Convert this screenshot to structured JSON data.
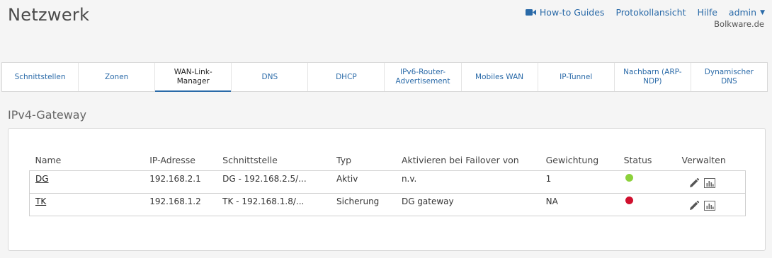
{
  "header": {
    "title": "Netzwerk",
    "hostname": "Bolkware.de",
    "nav": {
      "howto": "How-to Guides",
      "log": "Protokollansicht",
      "help": "Hilfe",
      "user": "admin"
    }
  },
  "tabs": [
    {
      "label": "Schnittstellen"
    },
    {
      "label": "Zonen"
    },
    {
      "label": "WAN-Link-Manager",
      "active": true
    },
    {
      "label": "DNS"
    },
    {
      "label": "DHCP"
    },
    {
      "label": "IPv6-Router-Advertisement"
    },
    {
      "label": "Mobiles WAN"
    },
    {
      "label": "IP-Tunnel"
    },
    {
      "label": "Nachbarn (ARP-NDP)"
    },
    {
      "label": "Dynamischer DNS"
    }
  ],
  "section": {
    "title": "IPv4-Gateway"
  },
  "table": {
    "headers": {
      "name": "Name",
      "ip": "IP-Adresse",
      "iface": "Schnittstelle",
      "type": "Typ",
      "failover": "Aktivieren bei Failover von",
      "weight": "Gewichtung",
      "status": "Status",
      "manage": "Verwalten"
    },
    "rows": [
      {
        "name": "DG",
        "ip": "192.168.2.1",
        "iface": "DG - 192.168.2.5/...",
        "type": "Aktiv",
        "failover": "n.v.",
        "weight": "1",
        "status_color": "#8cd13b"
      },
      {
        "name": "TK",
        "ip": "192.168.1.2",
        "iface": "TK - 192.168.1.8/...",
        "type": "Sicherung",
        "failover": "DG gateway",
        "weight": "NA",
        "status_color": "#d0102e"
      }
    ]
  },
  "colors": {
    "accent": "#2a6aa8",
    "status_up": "#8cd13b",
    "status_down": "#d0102e"
  }
}
